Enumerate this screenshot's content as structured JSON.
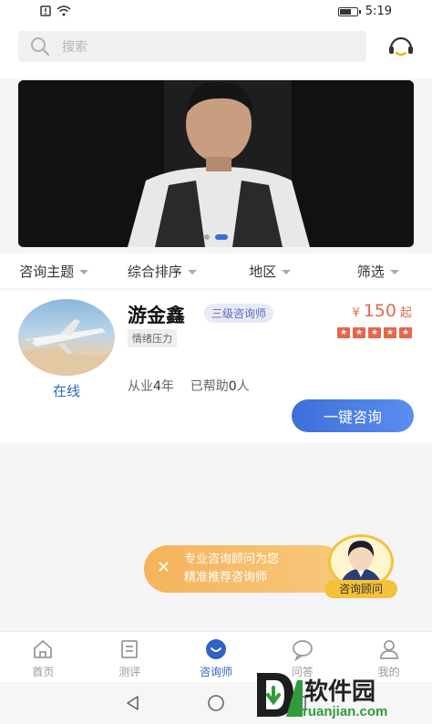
{
  "status_bar": {
    "time": "5:19"
  },
  "search": {
    "placeholder": "搜索"
  },
  "banner": {
    "slide_count": 2,
    "active_slide": 2
  },
  "filters": [
    {
      "label": "咨询主题"
    },
    {
      "label": "综合排序"
    },
    {
      "label": "地区"
    },
    {
      "label": "筛选"
    }
  ],
  "counselor": {
    "name": "游金鑫",
    "level": "三级咨询师",
    "tag": "情绪压力",
    "status": "在线",
    "price_symbol": "¥",
    "price": "150",
    "price_suffix": "起",
    "rating_stars": 5,
    "experience_prefix": "从业",
    "experience_years": "4",
    "experience_unit": "年",
    "helped_prefix": "已帮助",
    "helped_count": "0",
    "helped_unit": "人",
    "consult_button": "一键咨询"
  },
  "promo": {
    "line1": "专业咨询顾问为您",
    "line2": "精准推荐咨询师",
    "advisor_label": "咨询顾问"
  },
  "tabbar": [
    {
      "label": "首页",
      "icon": "home-icon"
    },
    {
      "label": "测评",
      "icon": "test-icon"
    },
    {
      "label": "咨询师",
      "icon": "counselor-icon",
      "active": true
    },
    {
      "label": "问答",
      "icon": "chat-icon"
    },
    {
      "label": "我的",
      "icon": "user-icon"
    }
  ],
  "watermark": {
    "brand": "软件园",
    "url": "ruanjian.com"
  },
  "colors": {
    "accent": "#2f64c2",
    "price": "#e06a52",
    "promo": "#f5b35c"
  }
}
